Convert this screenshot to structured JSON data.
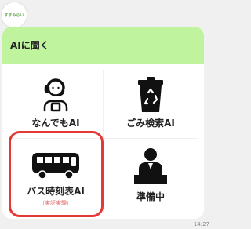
{
  "chat": {
    "avatar_label": "すまみらい",
    "timestamp": "14:27"
  },
  "menu": {
    "header": "AIに聞く",
    "tiles": [
      {
        "label": "なんでもAI",
        "icon": "operator-headset-icon"
      },
      {
        "label": "ごみ検索AI",
        "icon": "recycle-bin-icon"
      },
      {
        "label": "バス時刻表AI",
        "sublabel": "（実証実験）",
        "icon": "bus-icon"
      },
      {
        "label": "準備中",
        "icon": "person-at-desk-icon"
      }
    ]
  },
  "colors": {
    "header_bg": "#bff39e",
    "highlight": "#e53935",
    "icon": "#111111"
  }
}
